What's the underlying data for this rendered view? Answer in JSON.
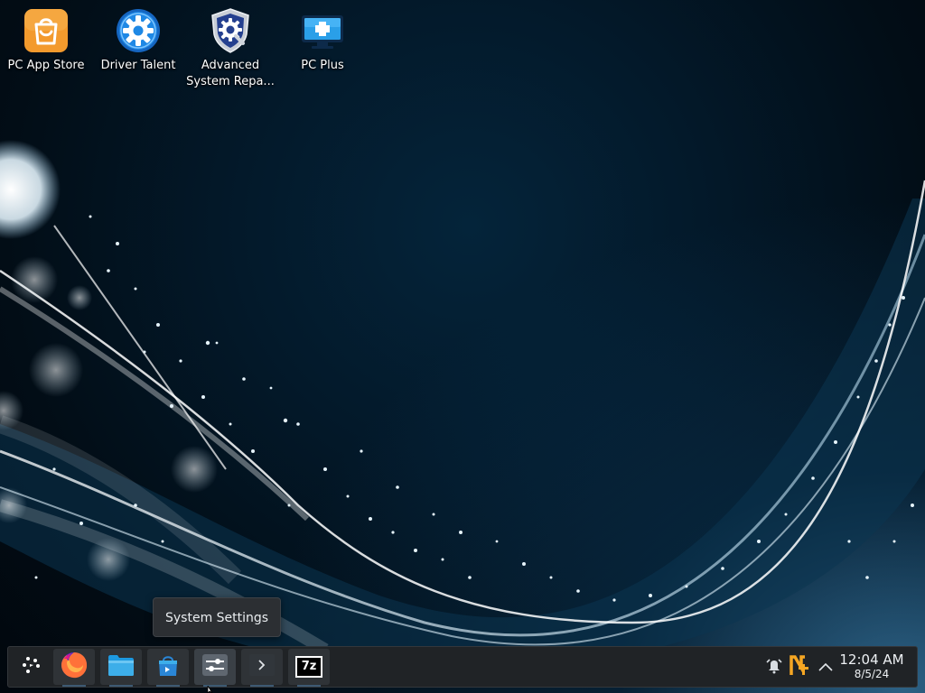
{
  "desktop": {
    "icons": [
      {
        "label": "PC App Store",
        "icon": "shopping-bag-icon"
      },
      {
        "label": "Driver Talent",
        "icon": "gear-icon"
      },
      {
        "label_line1": "Advanced",
        "label_line2": "System Repa...",
        "icon": "shield-gear-icon"
      },
      {
        "label": "PC Plus",
        "icon": "monitor-plus-icon"
      }
    ]
  },
  "tooltip": {
    "text": "System Settings"
  },
  "taskbar": {
    "items": [
      {
        "name": "application-launcher",
        "icon": "launcher-icon"
      },
      {
        "name": "firefox",
        "icon": "firefox-icon"
      },
      {
        "name": "file-manager",
        "icon": "folder-icon"
      },
      {
        "name": "discover",
        "icon": "store-bag-icon"
      },
      {
        "name": "system-settings",
        "icon": "settings-sliders-icon"
      },
      {
        "name": "terminal",
        "icon": "terminal-icon"
      },
      {
        "name": "7zip",
        "icon": "7z-icon",
        "label": "7z"
      }
    ],
    "tray": {
      "icons": [
        "alarm-icon",
        "update-notifier-icon",
        "chevron-up-icon"
      ]
    },
    "clock": {
      "time": "12:04 AM",
      "date": "8/5/24"
    }
  },
  "colors": {
    "taskbar_bg": "#202326",
    "accent_orange": "#f39a2d",
    "firefox_orange": "#ff7139",
    "folder_blue": "#3daee9",
    "tooltip_bg": "#2c2f33"
  }
}
